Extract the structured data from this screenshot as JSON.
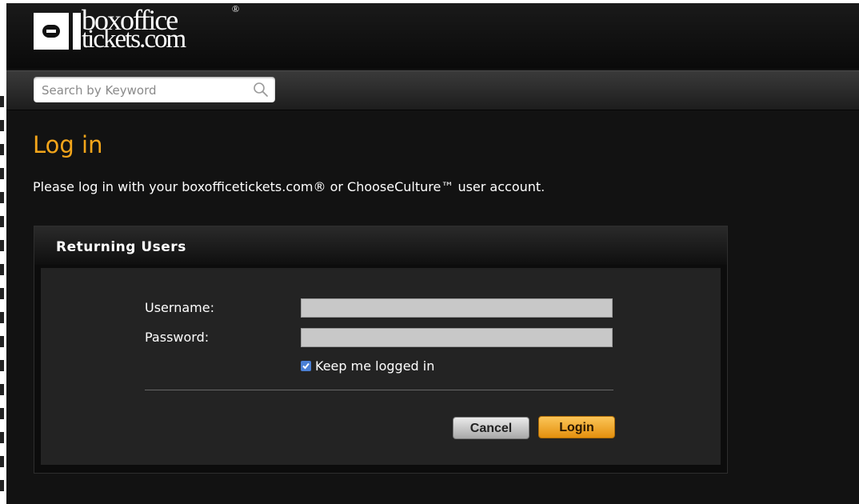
{
  "header": {
    "logo_line1": "boxoffice",
    "logo_line2": "tickets.com",
    "logo_reg": "®"
  },
  "search": {
    "placeholder": "Search by Keyword",
    "value": "",
    "icon": "search-icon"
  },
  "page": {
    "title": "Log in",
    "intro": "Please log in with your boxofficetickets.com® or ChooseCulture™ user account."
  },
  "panel": {
    "title": "Returning Users",
    "username_label": "Username:",
    "username_value": "",
    "password_label": "Password:",
    "password_value": "",
    "keep_logged_in_label": "Keep me logged in",
    "keep_logged_in_checked": true,
    "cancel_label": "Cancel",
    "login_label": "Login"
  },
  "colors": {
    "accent": "#f3a51a",
    "background": "#121212",
    "panel_body": "#232323",
    "login_button": "#f0a92e"
  }
}
